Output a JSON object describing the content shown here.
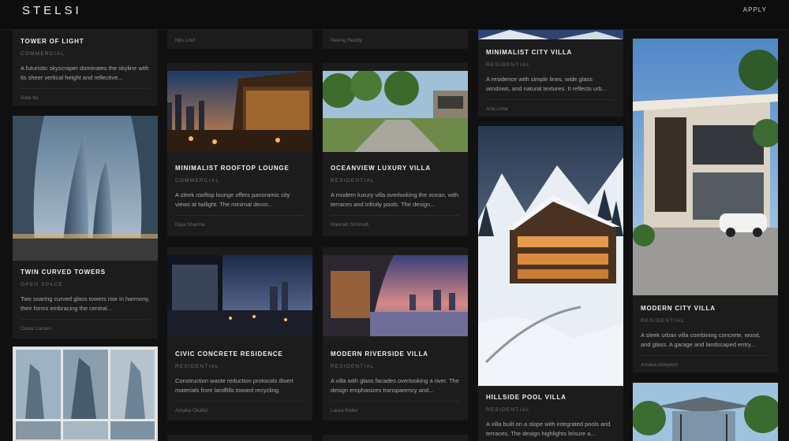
{
  "brand": {
    "name": "STELSI"
  },
  "header": {
    "apply_label": "APPLY"
  },
  "cards": {
    "tower_of_light": {
      "title": "TOWER OF LIGHT",
      "category": "COMMERCIAL",
      "description": "A futuristic skyscraper dominates the skyline with its sheer vertical height and reflective...",
      "author": "Sota Ito"
    },
    "twin_curved_towers": {
      "title": "TWIN CURVED TOWERS",
      "category": "OPEN SPACE",
      "description": "Two soaring curved glass towers rise in harmony, their forms embracing the central...",
      "author": "Oskar Larsen"
    },
    "col2_top": {
      "author": "Nils Lind"
    },
    "minimalist_rooftop_lounge": {
      "title": "MINIMALIST ROOFTOP LOUNGE",
      "category": "COMMERCIAL",
      "description": "A sleek rooftop lounge offers panoramic city views at twilight. The minimal decor...",
      "author": "Diya Sharma"
    },
    "civic_concrete_residence": {
      "title": "CIVIC CONCRETE RESIDENCE",
      "category": "RESIDENTIAL",
      "description": "Construction waste reduction protocols divert materials from landfills toward recycling.",
      "author": "Amaka Okafor"
    },
    "col3_top": {
      "author": "Neeraj Reddy"
    },
    "oceanview_luxury_villa": {
      "title": "OCEANVIEW LUXURY VILLA",
      "category": "RESIDENTIAL",
      "description": "A modern luxury villa overlooking the ocean, with terraces and infinity pools. The design...",
      "author": "Hannah Schmidt"
    },
    "modern_riverside_villa": {
      "title": "MODERN RIVERSIDE VILLA",
      "category": "RESIDENTIAL",
      "description": "A villa with glass facades overlooking a river. The design emphasizes transparency and...",
      "author": "Laura Keller"
    },
    "minimalist_city_villa": {
      "title": "MINIMALIST CITY VILLA",
      "category": "RESIDENTIAL",
      "description": "A residence with simple lines, wide glass windows, and natural textures. It reflects urb...",
      "author": "Ana Lima"
    },
    "hillside_pool_villa": {
      "title": "HILLSIDE POOL VILLA",
      "category": "RESIDENTIAL",
      "description": "A villa built on a slope with integrated pools and terraces. The design highlights leisure a..."
    },
    "modern_city_villa": {
      "title": "MODERN CITY VILLA",
      "category": "RESIDENTIAL",
      "description": "A sleek urban villa combining concrete, wood, and glass. A garage and landscaped entry...",
      "author": "Amaka Adeyemi"
    }
  }
}
